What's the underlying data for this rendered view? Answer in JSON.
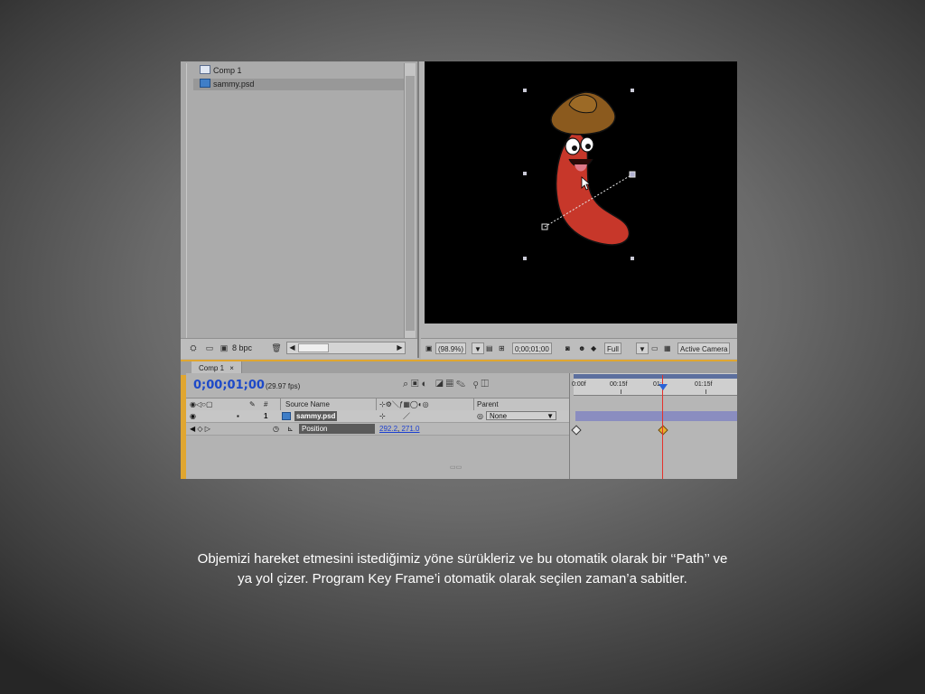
{
  "project": {
    "items": [
      {
        "name": "Comp 1",
        "icon": "composition-icon"
      },
      {
        "name": "sammy.psd",
        "icon": "psd-file-icon"
      }
    ],
    "footer": {
      "bit_depth": "8 bpc"
    }
  },
  "viewer": {
    "zoom": "(98.9%)",
    "timecode": "0;00;01;00",
    "resolution": "Full",
    "camera": "Active Camera"
  },
  "timeline": {
    "tab_label": "Comp 1",
    "timecode": "0;00;01;00",
    "fps": "(29.97 fps)",
    "headers": {
      "num": "#",
      "source_name": "Source Name",
      "parent": "Parent"
    },
    "layer": {
      "index": "1",
      "name": "sammy.psd",
      "parent": "None"
    },
    "property": {
      "name": "Position",
      "value_x": "292.2",
      "sep": ", ",
      "value_y": "271.0"
    },
    "ruler_labels": [
      "0:00f",
      "00:15f",
      "01:00f",
      "01:15f"
    ],
    "ruler_label_short": {
      "r0": "0:00f",
      "r1": "00:15f",
      "r2": "01:",
      "r2b": "f",
      "r3": "01:15f"
    }
  },
  "colors": {
    "character": "#c7372a",
    "hat": "#8b5a1e",
    "timecode": "#1d49c8",
    "playhead": "#e5312b",
    "accent_bar": "#e0a630"
  },
  "caption": "Objemizi hareket etmesini istediğimiz yöne sürükleriz ve bu otomatik olarak bir ‘‘Path’’ ve ya yol çizer. Program Key Frame’i otomatik olarak seçilen zaman’a sabitler."
}
